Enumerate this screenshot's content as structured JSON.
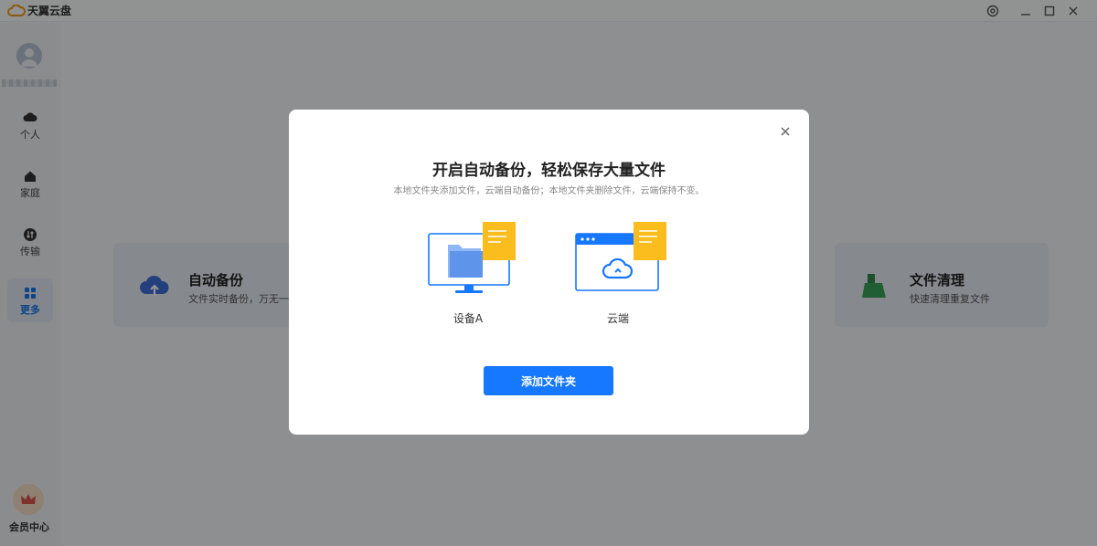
{
  "app": {
    "title": "天翼云盘"
  },
  "sidebar": {
    "items": [
      {
        "label": "个人",
        "icon": "cloud-icon"
      },
      {
        "label": "家庭",
        "icon": "home-icon"
      },
      {
        "label": "传输",
        "icon": "transfer-icon"
      },
      {
        "label": "更多",
        "icon": "grid-icon"
      }
    ],
    "vip_label": "会员中心"
  },
  "cards": [
    {
      "title": "自动备份",
      "desc": "文件实时备份，万无一失"
    },
    {
      "title": "文件清理",
      "desc": "快速清理重复文件"
    }
  ],
  "modal": {
    "title": "开启自动备份，轻松保存大量文件",
    "subtitle": "本地文件夹添加文件，云端自动备份；本地文件夹删除文件，云端保持不变。",
    "device_label": "设备A",
    "cloud_label": "云端",
    "button_label": "添加文件夹"
  },
  "colors": {
    "accent": "#1677ff",
    "doc": "#fbbd1e"
  }
}
